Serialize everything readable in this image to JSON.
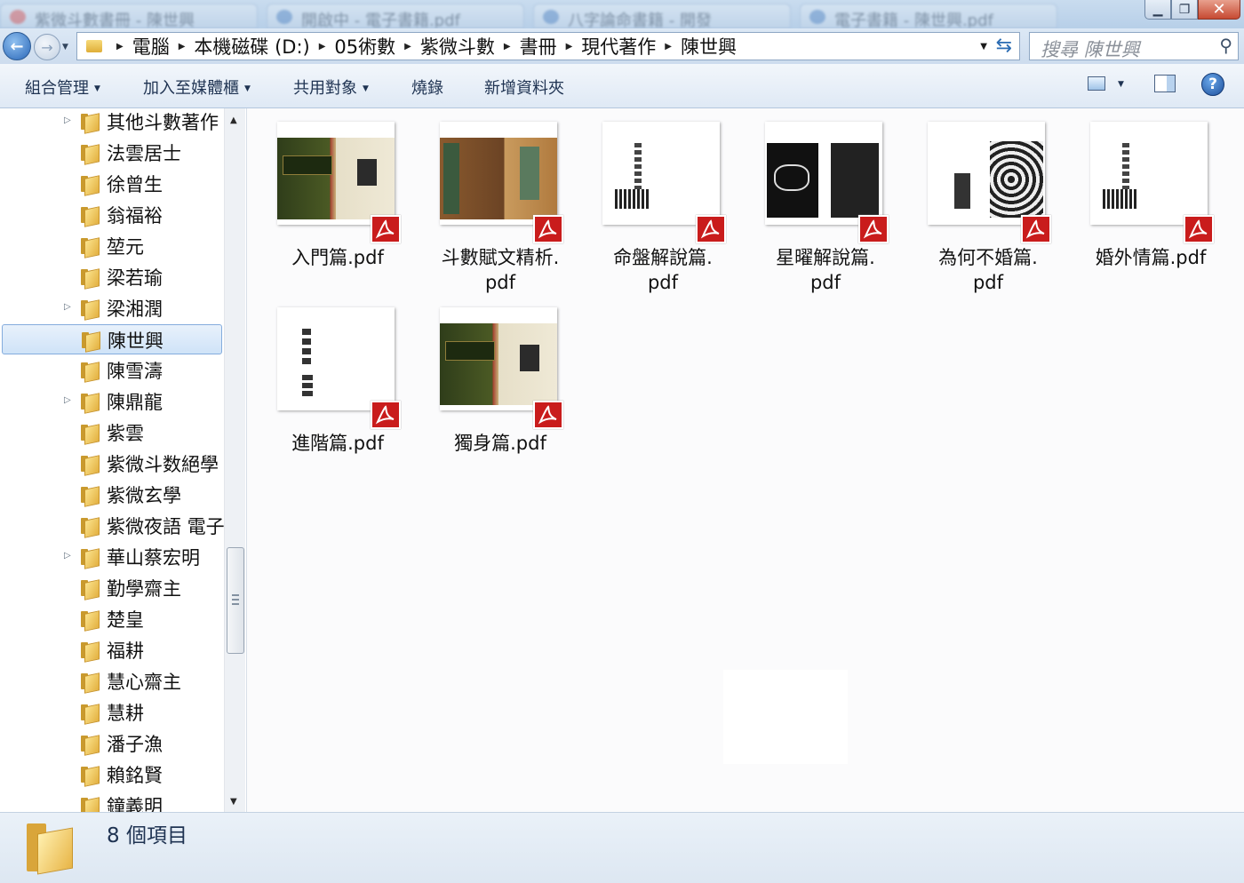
{
  "window": {
    "ghost_tabs": [
      "紫微斗數書冊 - 陳世興",
      "開啟中 - 電子書籍.pdf",
      "八字論命書籍 - 開發",
      "電子書籍 - 陳世興.pdf"
    ],
    "buttons": {
      "minimize": "▁",
      "maximize": "❐",
      "close": "✕"
    }
  },
  "address_bar": {
    "back_icon": "back-arrow-icon",
    "forward_icon": "forward-arrow-icon",
    "segments": [
      "電腦",
      "本機磁碟 (D:)",
      "05術數",
      "紫微斗數",
      "書冊",
      "現代著作",
      "陳世興"
    ]
  },
  "search": {
    "placeholder": "搜尋 陳世興"
  },
  "toolbar": {
    "organize": "組合管理",
    "add_to_library": "加入至媒體櫃",
    "share_with": "共用對象",
    "burn": "燒錄",
    "new_folder": "新增資料夾"
  },
  "nav_tree": [
    {
      "label": "其他斗數著作",
      "expandable": true,
      "selected": false
    },
    {
      "label": "法雲居士",
      "expandable": false,
      "selected": false
    },
    {
      "label": "徐曾生",
      "expandable": false,
      "selected": false
    },
    {
      "label": "翁福裕",
      "expandable": false,
      "selected": false
    },
    {
      "label": "堃元",
      "expandable": false,
      "selected": false
    },
    {
      "label": "梁若瑜",
      "expandable": false,
      "selected": false
    },
    {
      "label": "梁湘潤",
      "expandable": true,
      "selected": false
    },
    {
      "label": "陳世興",
      "expandable": false,
      "selected": true
    },
    {
      "label": "陳雪濤",
      "expandable": false,
      "selected": false
    },
    {
      "label": "陳鼎龍",
      "expandable": true,
      "selected": false
    },
    {
      "label": "紫雲",
      "expandable": false,
      "selected": false
    },
    {
      "label": "紫微斗数絕學",
      "expandable": false,
      "selected": false
    },
    {
      "label": "紫微玄學",
      "expandable": false,
      "selected": false
    },
    {
      "label": "紫微夜語 電子",
      "expandable": false,
      "selected": false
    },
    {
      "label": "華山蔡宏明",
      "expandable": true,
      "selected": false
    },
    {
      "label": "勤學齋主",
      "expandable": false,
      "selected": false
    },
    {
      "label": "楚皇",
      "expandable": false,
      "selected": false
    },
    {
      "label": "福耕",
      "expandable": false,
      "selected": false
    },
    {
      "label": "慧心齋主",
      "expandable": false,
      "selected": false
    },
    {
      "label": "慧耕",
      "expandable": false,
      "selected": false
    },
    {
      "label": "潘子漁",
      "expandable": false,
      "selected": false
    },
    {
      "label": "賴銘賢",
      "expandable": false,
      "selected": false
    },
    {
      "label": "鐘義明",
      "expandable": false,
      "selected": false
    }
  ],
  "files": [
    {
      "name_line1": "入門篇.pdf",
      "name_line2": "",
      "cover": "dark-green"
    },
    {
      "name_line1": "斗數賦文精析.",
      "name_line2": "pdf",
      "cover": "brown"
    },
    {
      "name_line1": "命盤解說篇.",
      "name_line2": "pdf",
      "cover": "white-text"
    },
    {
      "name_line1": "星曜解說篇.",
      "name_line2": "pdf",
      "cover": "black-white"
    },
    {
      "name_line1": "為何不婚篇.",
      "name_line2": "pdf",
      "cover": "white-swirl"
    },
    {
      "name_line1": "婚外情篇.pdf",
      "name_line2": "",
      "cover": "white-text"
    },
    {
      "name_line1": "進階篇.pdf",
      "name_line2": "",
      "cover": "white-vertical"
    },
    {
      "name_line1": "獨身篇.pdf",
      "name_line2": "",
      "cover": "dark-green"
    }
  ],
  "status": {
    "item_count": "8 個項目"
  },
  "colors": {
    "pdf_badge": "#c91c1c",
    "selection": "#cfe3f8",
    "folder": "#e3b03f"
  }
}
